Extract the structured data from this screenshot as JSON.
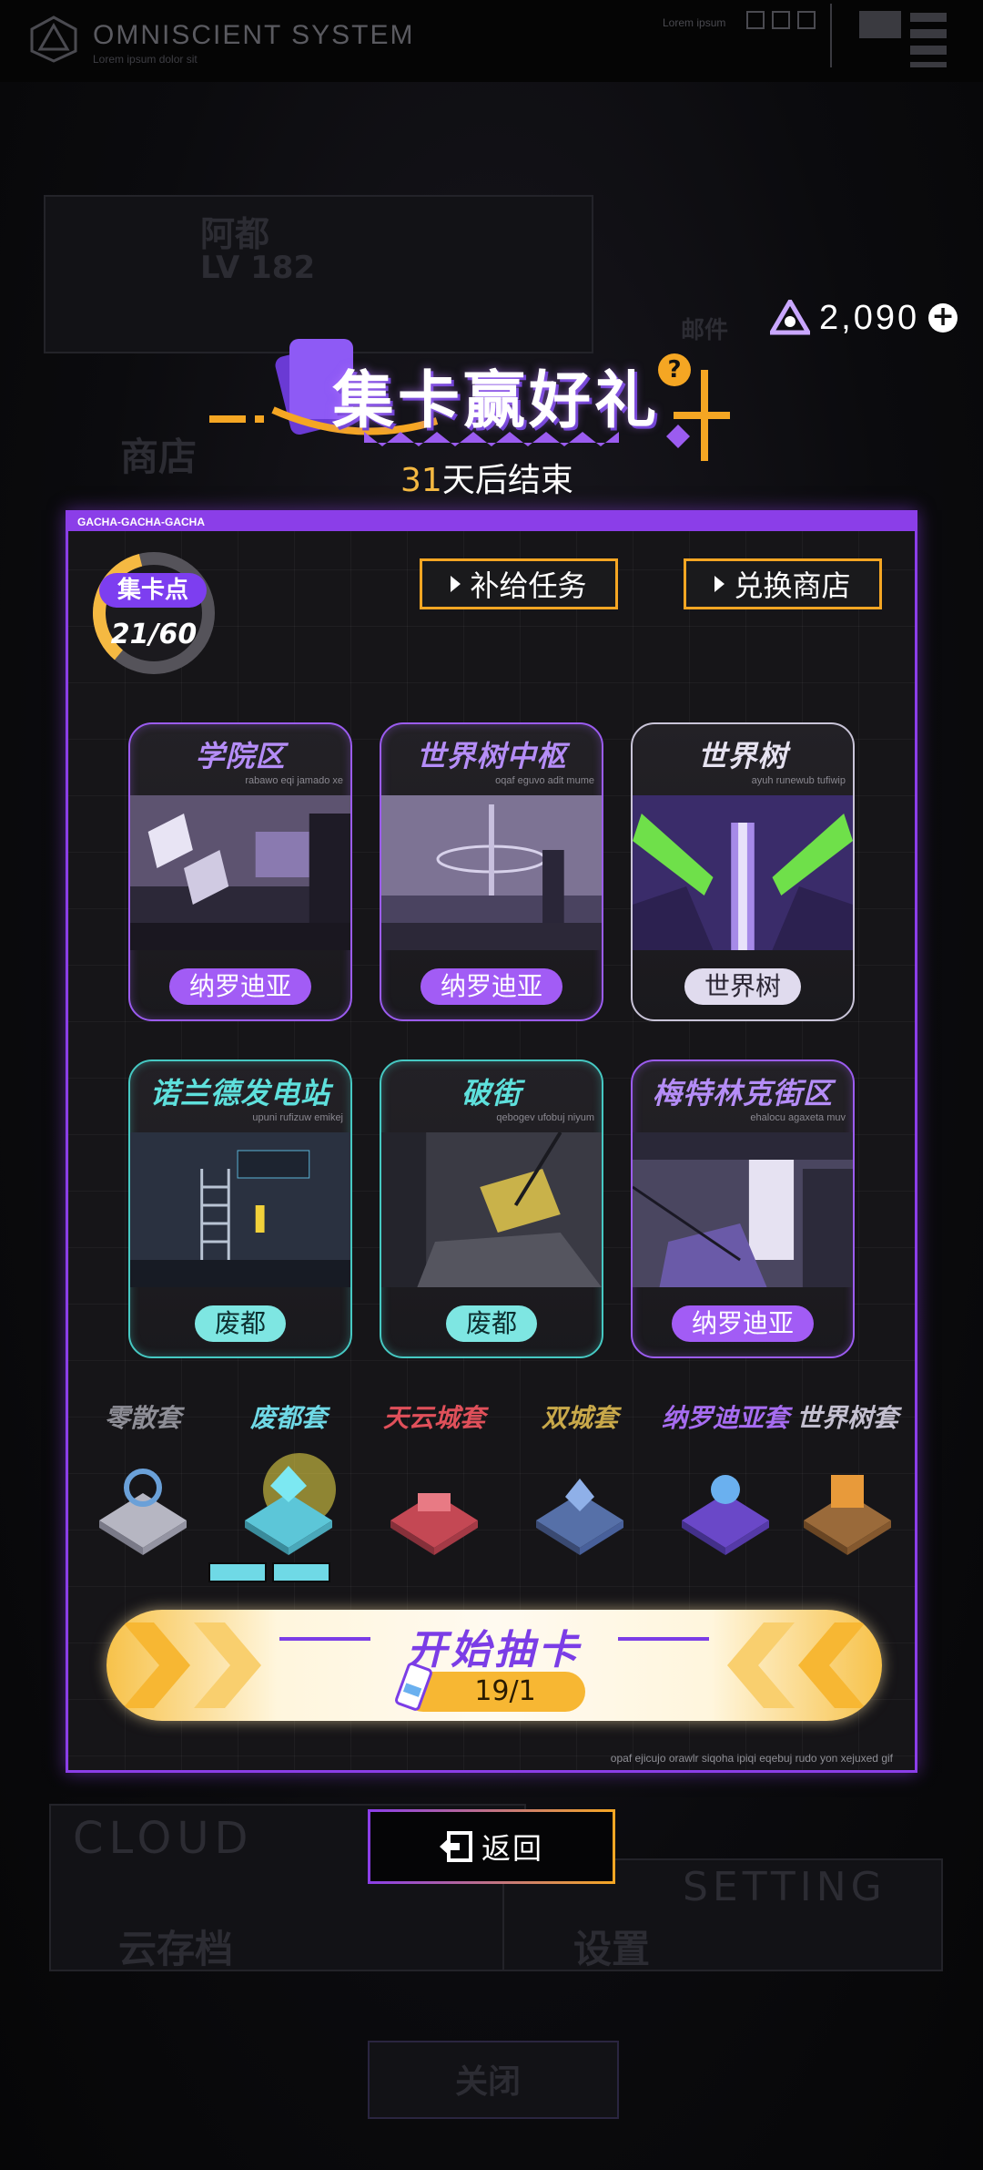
{
  "system": {
    "title": "OMNISCIENT SYSTEM",
    "subtitle": "Lorem ipsum dolor sit",
    "right_text": "Lorem ipsum"
  },
  "background": {
    "player_name": "阿都",
    "player_level": "LV 182",
    "shop": "商店",
    "mail": "邮件",
    "cloud_label": "CLOUD",
    "cloud_save": "云存档",
    "setting_label": "SETTING",
    "settings": "设置",
    "close": "关闭"
  },
  "currency": {
    "amount": "2,090",
    "icon": "gem-icon",
    "plus_icon": "plus-icon"
  },
  "event": {
    "title": "集卡赢好礼",
    "help": "?",
    "days_number": "31",
    "days_suffix": "天后结束"
  },
  "panel": {
    "header": "GACHA-GACHA-GACHA",
    "footer": "opaf ejicujo orawlr siqoha ipiqi eqebuj rudo yon xejuxed gif",
    "points_label": "集卡点",
    "points_value": "21/60",
    "points_progress": 0.35,
    "supply_task": "补给任务",
    "exchange_shop": "兑换商店"
  },
  "cards": [
    {
      "name": "学院区",
      "sub": "rabawo eqi jamado xe",
      "tag": "纳罗迪亚",
      "theme": "purple"
    },
    {
      "name": "世界树中枢",
      "sub": "oqaf eguvo adit mume",
      "tag": "纳罗迪亚",
      "theme": "purple"
    },
    {
      "name": "世界树",
      "sub": "ayuh runewub tufiwip",
      "tag": "世界树",
      "theme": "white"
    },
    {
      "name": "诺兰德发电站",
      "sub": "upuni rufizuw emikej",
      "tag": "废都",
      "theme": "teal"
    },
    {
      "name": "破街",
      "sub": "qebogev ufobuj niyum",
      "tag": "废都",
      "theme": "teal"
    },
    {
      "name": "梅特林克街区",
      "sub": "ehalocu agaxeta muv",
      "tag": "纳罗迪亚",
      "theme": "purple"
    }
  ],
  "sets": [
    {
      "name": "零散套",
      "color": "#8e8e96"
    },
    {
      "name": "废都套",
      "color": "#6fd9e6"
    },
    {
      "name": "天云城套",
      "color": "#e0505a"
    },
    {
      "name": "双城套",
      "color": "#c9a94a"
    },
    {
      "name": "纳罗迪亚套",
      "color": "#a66cf0"
    },
    {
      "name": "世界树套",
      "color": "#c4c0d0"
    }
  ],
  "draw": {
    "label": "开始抽卡",
    "cost": "19/1"
  },
  "return_button": "返回"
}
